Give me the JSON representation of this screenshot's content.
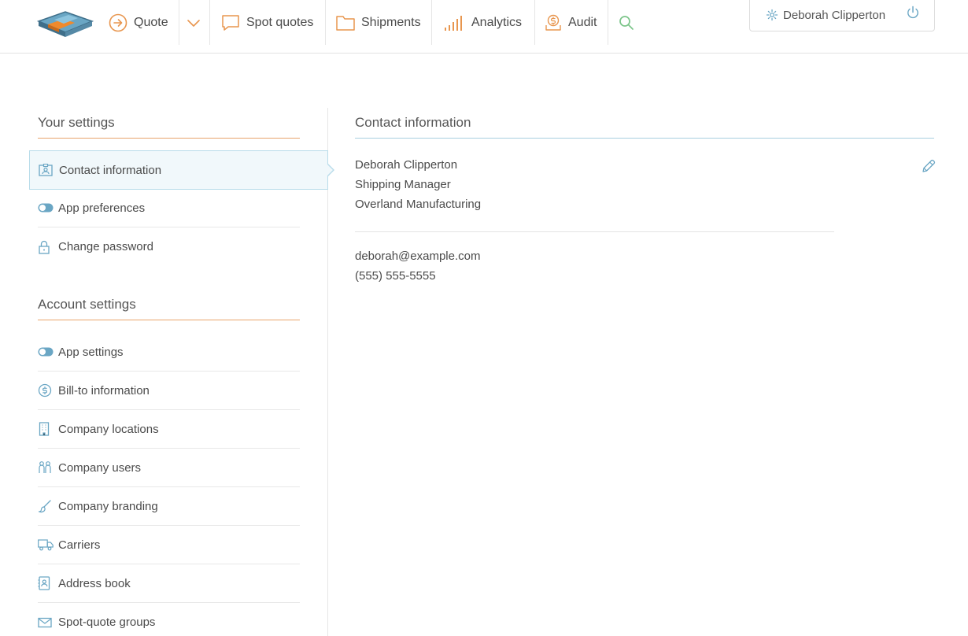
{
  "nav": {
    "quote_label": "Quote",
    "spot_quotes_label": "Spot quotes",
    "shipments_label": "Shipments",
    "analytics_label": "Analytics",
    "audit_label": "Audit",
    "user_name": "Deborah Clipperton"
  },
  "sidebar": {
    "your_settings_title": "Your settings",
    "your_settings_items": [
      {
        "label": "Contact information",
        "icon": "contact-card-icon"
      },
      {
        "label": "App preferences",
        "icon": "toggle-icon"
      },
      {
        "label": "Change password",
        "icon": "lock-icon"
      }
    ],
    "account_settings_title": "Account settings",
    "account_settings_items": [
      {
        "label": "App settings",
        "icon": "toggle-icon"
      },
      {
        "label": "Bill-to information",
        "icon": "dollar-circle-icon"
      },
      {
        "label": "Company locations",
        "icon": "building-icon"
      },
      {
        "label": "Company users",
        "icon": "users-icon"
      },
      {
        "label": "Company branding",
        "icon": "brush-icon"
      },
      {
        "label": "Carriers",
        "icon": "truck-icon"
      },
      {
        "label": "Address book",
        "icon": "address-book-icon"
      },
      {
        "label": "Spot-quote groups",
        "icon": "envelope-icon"
      }
    ]
  },
  "contact": {
    "title": "Contact information",
    "name": "Deborah Clipperton",
    "job_title": "Shipping Manager",
    "company": "Overland Manufacturing",
    "email": "deborah@example.com",
    "phone": "(555) 555-5555"
  },
  "colors": {
    "accent_orange": "#e8a46c",
    "accent_blue": "#6aa6c4",
    "active_bg": "#f1f8fb",
    "search_green": "#7cc58a"
  }
}
